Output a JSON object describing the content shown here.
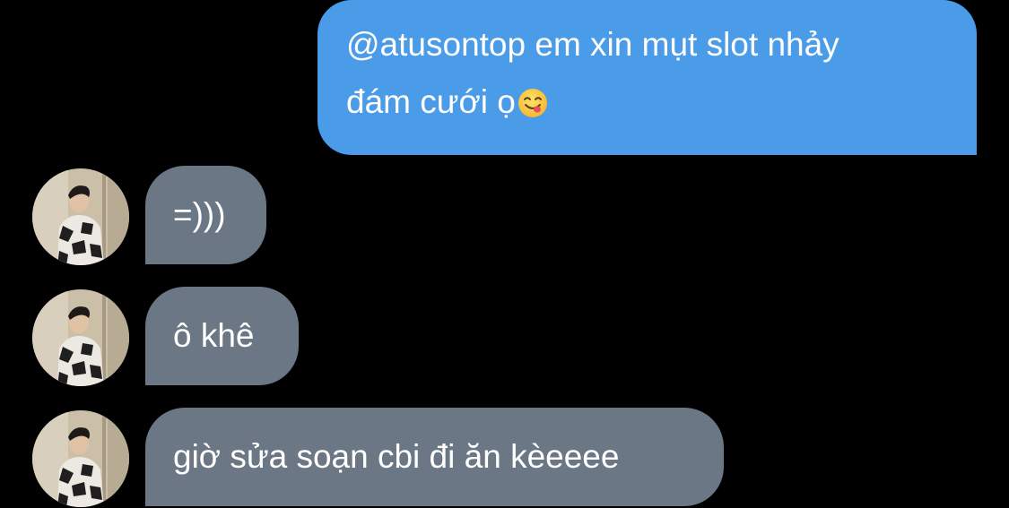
{
  "conversation": {
    "outgoing": {
      "line1": "@atusontop em xin mụt slot nhảy",
      "line2": "đám cưới ọ",
      "emoji": "face-savoring-food-emoji"
    },
    "incoming": [
      {
        "text": "=)))"
      },
      {
        "text": "ô khê"
      },
      {
        "text": "giờ sửa soạn cbi đi ăn kèeeee"
      }
    ]
  },
  "colors": {
    "background": "#000000",
    "outgoing_bubble": "#4a9be8",
    "incoming_bubble": "#6b7785",
    "text": "#ffffff"
  }
}
